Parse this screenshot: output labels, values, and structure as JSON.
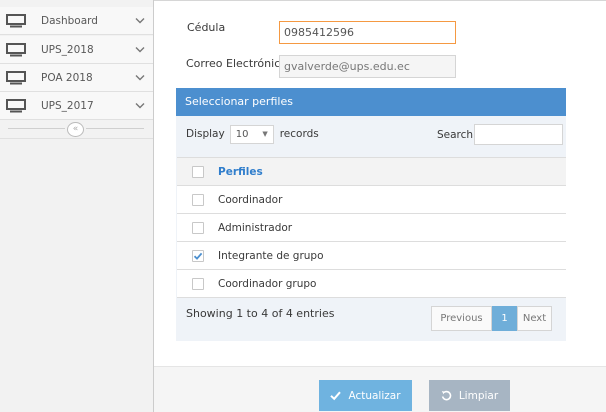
{
  "sidebar": {
    "items": [
      {
        "label": "Dashboard"
      },
      {
        "label": "UPS_2018"
      },
      {
        "label": "POA 2018"
      },
      {
        "label": "UPS_2017"
      }
    ],
    "collapse_glyph": "«"
  },
  "form": {
    "cedula": {
      "label": "Cédula",
      "value": "0985412596"
    },
    "correo": {
      "label": "Correo Electrónico",
      "value": "gvalverde@ups.edu.ec"
    }
  },
  "panel": {
    "title": "Seleccionar perfiles",
    "display_label": "Display",
    "page_size": "10",
    "records_label": "records",
    "search_label": "Search:",
    "search_value": "",
    "column_header": "Perfiles",
    "rows": [
      {
        "label": "Coordinador",
        "checked": false
      },
      {
        "label": "Administrador",
        "checked": false
      },
      {
        "label": "Integrante de grupo",
        "checked": true
      },
      {
        "label": "Coordinador grupo",
        "checked": false
      }
    ],
    "showing": "Showing 1 to 4 of 4 entries",
    "pager": {
      "previous": "Previous",
      "current": "1",
      "next": "Next"
    }
  },
  "actions": {
    "update_label": "Actualizar",
    "clear_label": "Limpiar"
  },
  "colors": {
    "panel_header": "#4c8fcf",
    "header_text": "#307ecc",
    "focus_border": "#f59942",
    "update_button": "#6fb3e0",
    "clear_button": "#a7b5c3",
    "page_current": "#6faed9"
  }
}
